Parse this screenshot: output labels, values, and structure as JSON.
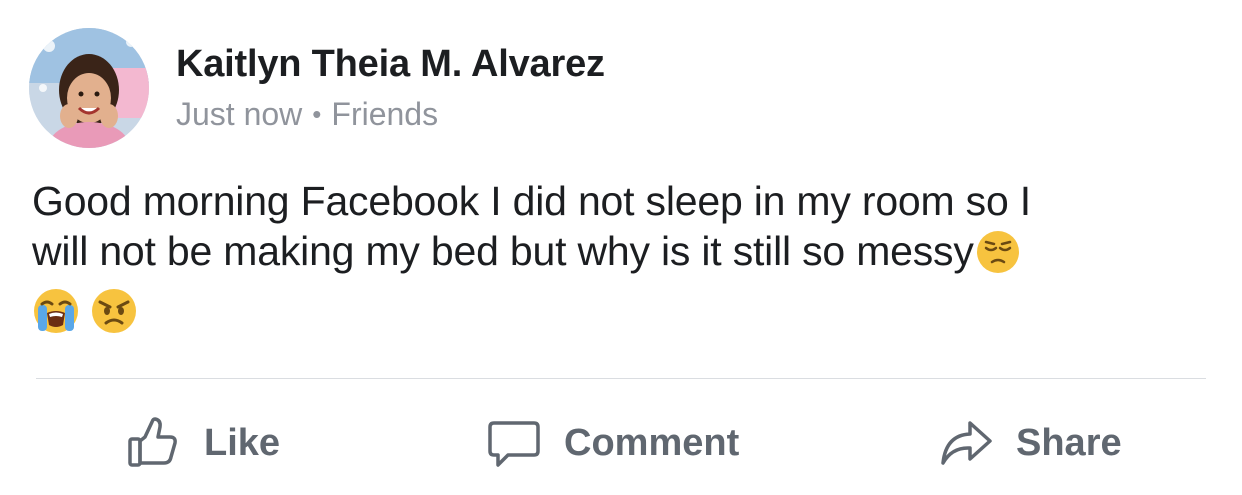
{
  "post": {
    "author": "Kaitlyn Theia M. Alvarez",
    "timestamp": "Just now",
    "separator": "•",
    "audience": "Friends",
    "text_line1": "Good morning Facebook I did not sleep in my room so I",
    "text_line2": "will not be making my bed but why is it still so messy",
    "emojis": [
      "pensive-face",
      "loudly-crying-face",
      "angry-face"
    ]
  },
  "actions": {
    "like_label": "Like",
    "comment_label": "Comment",
    "share_label": "Share"
  },
  "colors": {
    "text_primary": "#1c1e21",
    "text_secondary": "#90949c",
    "action_gray": "#606770",
    "divider": "#dadde1"
  }
}
